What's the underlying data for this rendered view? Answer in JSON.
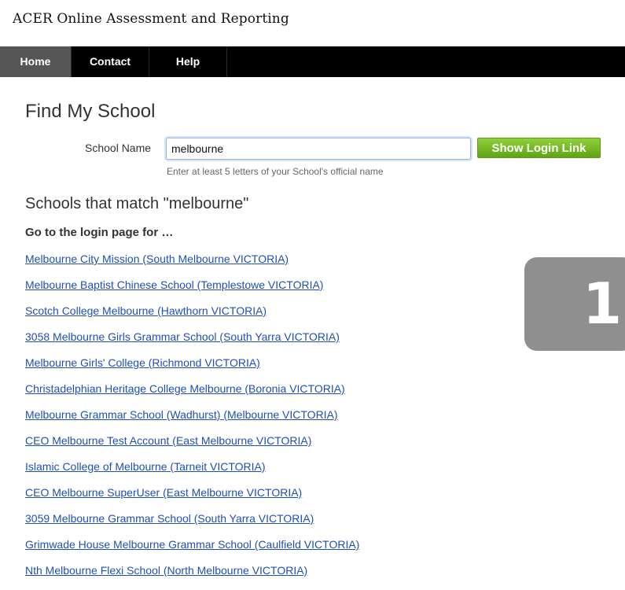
{
  "app": {
    "title": "ACER Online Assessment and Reporting"
  },
  "nav": {
    "items": [
      {
        "label": "Home",
        "active": true
      },
      {
        "label": "Contact",
        "active": false
      },
      {
        "label": "Help",
        "active": false
      }
    ]
  },
  "find": {
    "title": "Find My School",
    "field_label": "School Name",
    "input_value": "melbourne",
    "button_label": "Show Login Link",
    "hint": "Enter at least 5 letters of your School's official name"
  },
  "results": {
    "title": "Schools that match \"melbourne\"",
    "subtitle": "Go to the login page for …",
    "links": [
      "Melbourne City Mission (South Melbourne VICTORIA)",
      "Melbourne Baptist Chinese School (Templestowe VICTORIA)",
      "Scotch College Melbourne (Hawthorn VICTORIA)",
      "3058 Melbourne Girls Grammar School (South Yarra VICTORIA)",
      "Melbourne Girls' College (Richmond VICTORIA)",
      "Christadelphian Heritage College Melbourne (Boronia VICTORIA)",
      "Melbourne Grammar School (Wadhurst) (Melbourne VICTORIA)",
      "CEO Melbourne Test Account (East Melbourne VICTORIA)",
      "Islamic College of Melbourne (Tarneit VICTORIA)",
      "CEO Melbourne SuperUser (East Melbourne VICTORIA)",
      "3059 Melbourne Grammar School (South Yarra VICTORIA)",
      "Grimwade House Melbourne Grammar School (Caulfield VICTORIA)",
      "Nth Melbourne Flexi School (North Melbourne VICTORIA)"
    ]
  },
  "badge": {
    "number": "1"
  },
  "colors": {
    "nav_background": "#000000",
    "nav_active": "#555555",
    "link": "#1f4fb5",
    "button_green": "#6cb51f",
    "badge_gray": "#8f8f8f"
  }
}
